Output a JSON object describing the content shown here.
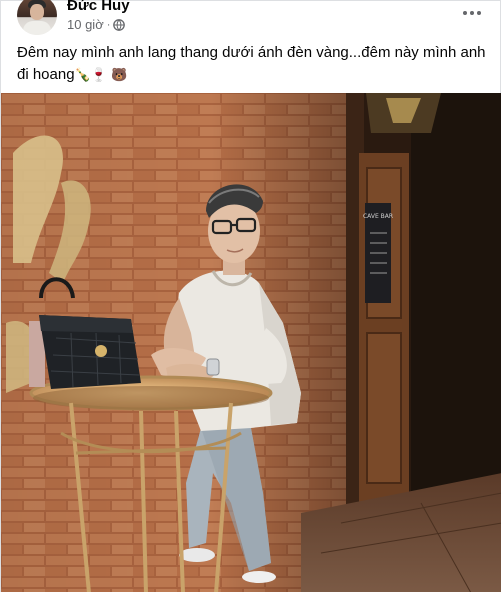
{
  "post": {
    "author_name": "Đức Huy",
    "timestamp": "10 giờ",
    "separator": "·",
    "audience_icon": "globe-icon",
    "more_icon": "more-options-icon",
    "caption_text": "Đêm nay mình anh lang thang dưới ánh đèn vàng...đêm này mình anh đi hoang",
    "caption_emojis": "🍾🍷 🐻",
    "photo": {
      "description_icon": "photo",
      "door_sign_text": "CAVE BAR"
    }
  },
  "colors": {
    "name": "#050505",
    "meta": "#65676b",
    "brick": "#b06a44",
    "wood": "#6a3a1f",
    "table_top": "#d9a86a"
  }
}
